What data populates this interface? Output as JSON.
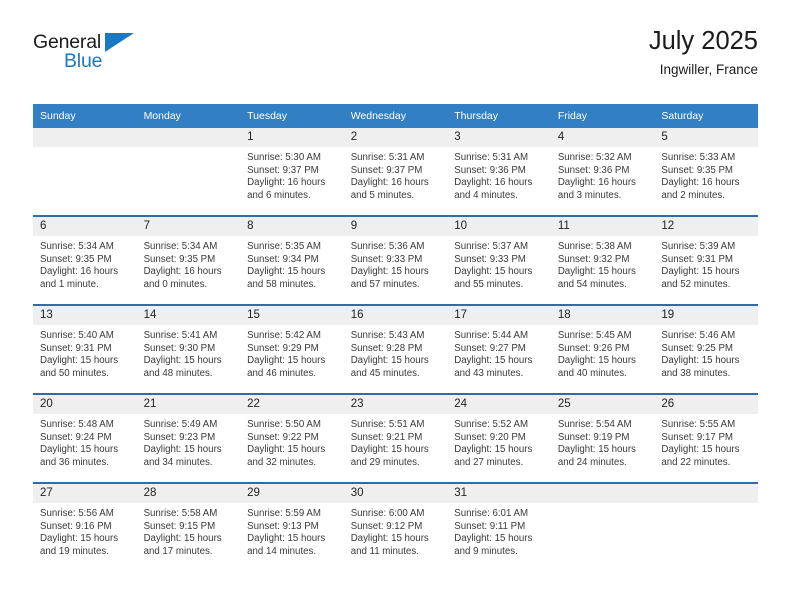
{
  "brand": {
    "line1": "General",
    "line2": "Blue",
    "accent_color": "#1c79c0"
  },
  "header": {
    "title": "July 2025",
    "subtitle": "Ingwiller, France"
  },
  "theme": {
    "header_bg": "#3280c3",
    "row_divider": "#2e6da8",
    "daynum_bg": "#efefef",
    "text": "#222222"
  },
  "weekday_headers": [
    "Sunday",
    "Monday",
    "Tuesday",
    "Wednesday",
    "Thursday",
    "Friday",
    "Saturday"
  ],
  "weeks": [
    [
      {
        "day": "",
        "sunrise": "",
        "sunset": "",
        "daylight_line1": "",
        "daylight_line2": ""
      },
      {
        "day": "",
        "sunrise": "",
        "sunset": "",
        "daylight_line1": "",
        "daylight_line2": ""
      },
      {
        "day": "1",
        "sunrise": "Sunrise: 5:30 AM",
        "sunset": "Sunset: 9:37 PM",
        "daylight_line1": "Daylight: 16 hours",
        "daylight_line2": "and 6 minutes."
      },
      {
        "day": "2",
        "sunrise": "Sunrise: 5:31 AM",
        "sunset": "Sunset: 9:37 PM",
        "daylight_line1": "Daylight: 16 hours",
        "daylight_line2": "and 5 minutes."
      },
      {
        "day": "3",
        "sunrise": "Sunrise: 5:31 AM",
        "sunset": "Sunset: 9:36 PM",
        "daylight_line1": "Daylight: 16 hours",
        "daylight_line2": "and 4 minutes."
      },
      {
        "day": "4",
        "sunrise": "Sunrise: 5:32 AM",
        "sunset": "Sunset: 9:36 PM",
        "daylight_line1": "Daylight: 16 hours",
        "daylight_line2": "and 3 minutes."
      },
      {
        "day": "5",
        "sunrise": "Sunrise: 5:33 AM",
        "sunset": "Sunset: 9:35 PM",
        "daylight_line1": "Daylight: 16 hours",
        "daylight_line2": "and 2 minutes."
      }
    ],
    [
      {
        "day": "6",
        "sunrise": "Sunrise: 5:34 AM",
        "sunset": "Sunset: 9:35 PM",
        "daylight_line1": "Daylight: 16 hours",
        "daylight_line2": "and 1 minute."
      },
      {
        "day": "7",
        "sunrise": "Sunrise: 5:34 AM",
        "sunset": "Sunset: 9:35 PM",
        "daylight_line1": "Daylight: 16 hours",
        "daylight_line2": "and 0 minutes."
      },
      {
        "day": "8",
        "sunrise": "Sunrise: 5:35 AM",
        "sunset": "Sunset: 9:34 PM",
        "daylight_line1": "Daylight: 15 hours",
        "daylight_line2": "and 58 minutes."
      },
      {
        "day": "9",
        "sunrise": "Sunrise: 5:36 AM",
        "sunset": "Sunset: 9:33 PM",
        "daylight_line1": "Daylight: 15 hours",
        "daylight_line2": "and 57 minutes."
      },
      {
        "day": "10",
        "sunrise": "Sunrise: 5:37 AM",
        "sunset": "Sunset: 9:33 PM",
        "daylight_line1": "Daylight: 15 hours",
        "daylight_line2": "and 55 minutes."
      },
      {
        "day": "11",
        "sunrise": "Sunrise: 5:38 AM",
        "sunset": "Sunset: 9:32 PM",
        "daylight_line1": "Daylight: 15 hours",
        "daylight_line2": "and 54 minutes."
      },
      {
        "day": "12",
        "sunrise": "Sunrise: 5:39 AM",
        "sunset": "Sunset: 9:31 PM",
        "daylight_line1": "Daylight: 15 hours",
        "daylight_line2": "and 52 minutes."
      }
    ],
    [
      {
        "day": "13",
        "sunrise": "Sunrise: 5:40 AM",
        "sunset": "Sunset: 9:31 PM",
        "daylight_line1": "Daylight: 15 hours",
        "daylight_line2": "and 50 minutes."
      },
      {
        "day": "14",
        "sunrise": "Sunrise: 5:41 AM",
        "sunset": "Sunset: 9:30 PM",
        "daylight_line1": "Daylight: 15 hours",
        "daylight_line2": "and 48 minutes."
      },
      {
        "day": "15",
        "sunrise": "Sunrise: 5:42 AM",
        "sunset": "Sunset: 9:29 PM",
        "daylight_line1": "Daylight: 15 hours",
        "daylight_line2": "and 46 minutes."
      },
      {
        "day": "16",
        "sunrise": "Sunrise: 5:43 AM",
        "sunset": "Sunset: 9:28 PM",
        "daylight_line1": "Daylight: 15 hours",
        "daylight_line2": "and 45 minutes."
      },
      {
        "day": "17",
        "sunrise": "Sunrise: 5:44 AM",
        "sunset": "Sunset: 9:27 PM",
        "daylight_line1": "Daylight: 15 hours",
        "daylight_line2": "and 43 minutes."
      },
      {
        "day": "18",
        "sunrise": "Sunrise: 5:45 AM",
        "sunset": "Sunset: 9:26 PM",
        "daylight_line1": "Daylight: 15 hours",
        "daylight_line2": "and 40 minutes."
      },
      {
        "day": "19",
        "sunrise": "Sunrise: 5:46 AM",
        "sunset": "Sunset: 9:25 PM",
        "daylight_line1": "Daylight: 15 hours",
        "daylight_line2": "and 38 minutes."
      }
    ],
    [
      {
        "day": "20",
        "sunrise": "Sunrise: 5:48 AM",
        "sunset": "Sunset: 9:24 PM",
        "daylight_line1": "Daylight: 15 hours",
        "daylight_line2": "and 36 minutes."
      },
      {
        "day": "21",
        "sunrise": "Sunrise: 5:49 AM",
        "sunset": "Sunset: 9:23 PM",
        "daylight_line1": "Daylight: 15 hours",
        "daylight_line2": "and 34 minutes."
      },
      {
        "day": "22",
        "sunrise": "Sunrise: 5:50 AM",
        "sunset": "Sunset: 9:22 PM",
        "daylight_line1": "Daylight: 15 hours",
        "daylight_line2": "and 32 minutes."
      },
      {
        "day": "23",
        "sunrise": "Sunrise: 5:51 AM",
        "sunset": "Sunset: 9:21 PM",
        "daylight_line1": "Daylight: 15 hours",
        "daylight_line2": "and 29 minutes."
      },
      {
        "day": "24",
        "sunrise": "Sunrise: 5:52 AM",
        "sunset": "Sunset: 9:20 PM",
        "daylight_line1": "Daylight: 15 hours",
        "daylight_line2": "and 27 minutes."
      },
      {
        "day": "25",
        "sunrise": "Sunrise: 5:54 AM",
        "sunset": "Sunset: 9:19 PM",
        "daylight_line1": "Daylight: 15 hours",
        "daylight_line2": "and 24 minutes."
      },
      {
        "day": "26",
        "sunrise": "Sunrise: 5:55 AM",
        "sunset": "Sunset: 9:17 PM",
        "daylight_line1": "Daylight: 15 hours",
        "daylight_line2": "and 22 minutes."
      }
    ],
    [
      {
        "day": "27",
        "sunrise": "Sunrise: 5:56 AM",
        "sunset": "Sunset: 9:16 PM",
        "daylight_line1": "Daylight: 15 hours",
        "daylight_line2": "and 19 minutes."
      },
      {
        "day": "28",
        "sunrise": "Sunrise: 5:58 AM",
        "sunset": "Sunset: 9:15 PM",
        "daylight_line1": "Daylight: 15 hours",
        "daylight_line2": "and 17 minutes."
      },
      {
        "day": "29",
        "sunrise": "Sunrise: 5:59 AM",
        "sunset": "Sunset: 9:13 PM",
        "daylight_line1": "Daylight: 15 hours",
        "daylight_line2": "and 14 minutes."
      },
      {
        "day": "30",
        "sunrise": "Sunrise: 6:00 AM",
        "sunset": "Sunset: 9:12 PM",
        "daylight_line1": "Daylight: 15 hours",
        "daylight_line2": "and 11 minutes."
      },
      {
        "day": "31",
        "sunrise": "Sunrise: 6:01 AM",
        "sunset": "Sunset: 9:11 PM",
        "daylight_line1": "Daylight: 15 hours",
        "daylight_line2": "and 9 minutes."
      },
      {
        "day": "",
        "sunrise": "",
        "sunset": "",
        "daylight_line1": "",
        "daylight_line2": ""
      },
      {
        "day": "",
        "sunrise": "",
        "sunset": "",
        "daylight_line1": "",
        "daylight_line2": ""
      }
    ]
  ]
}
